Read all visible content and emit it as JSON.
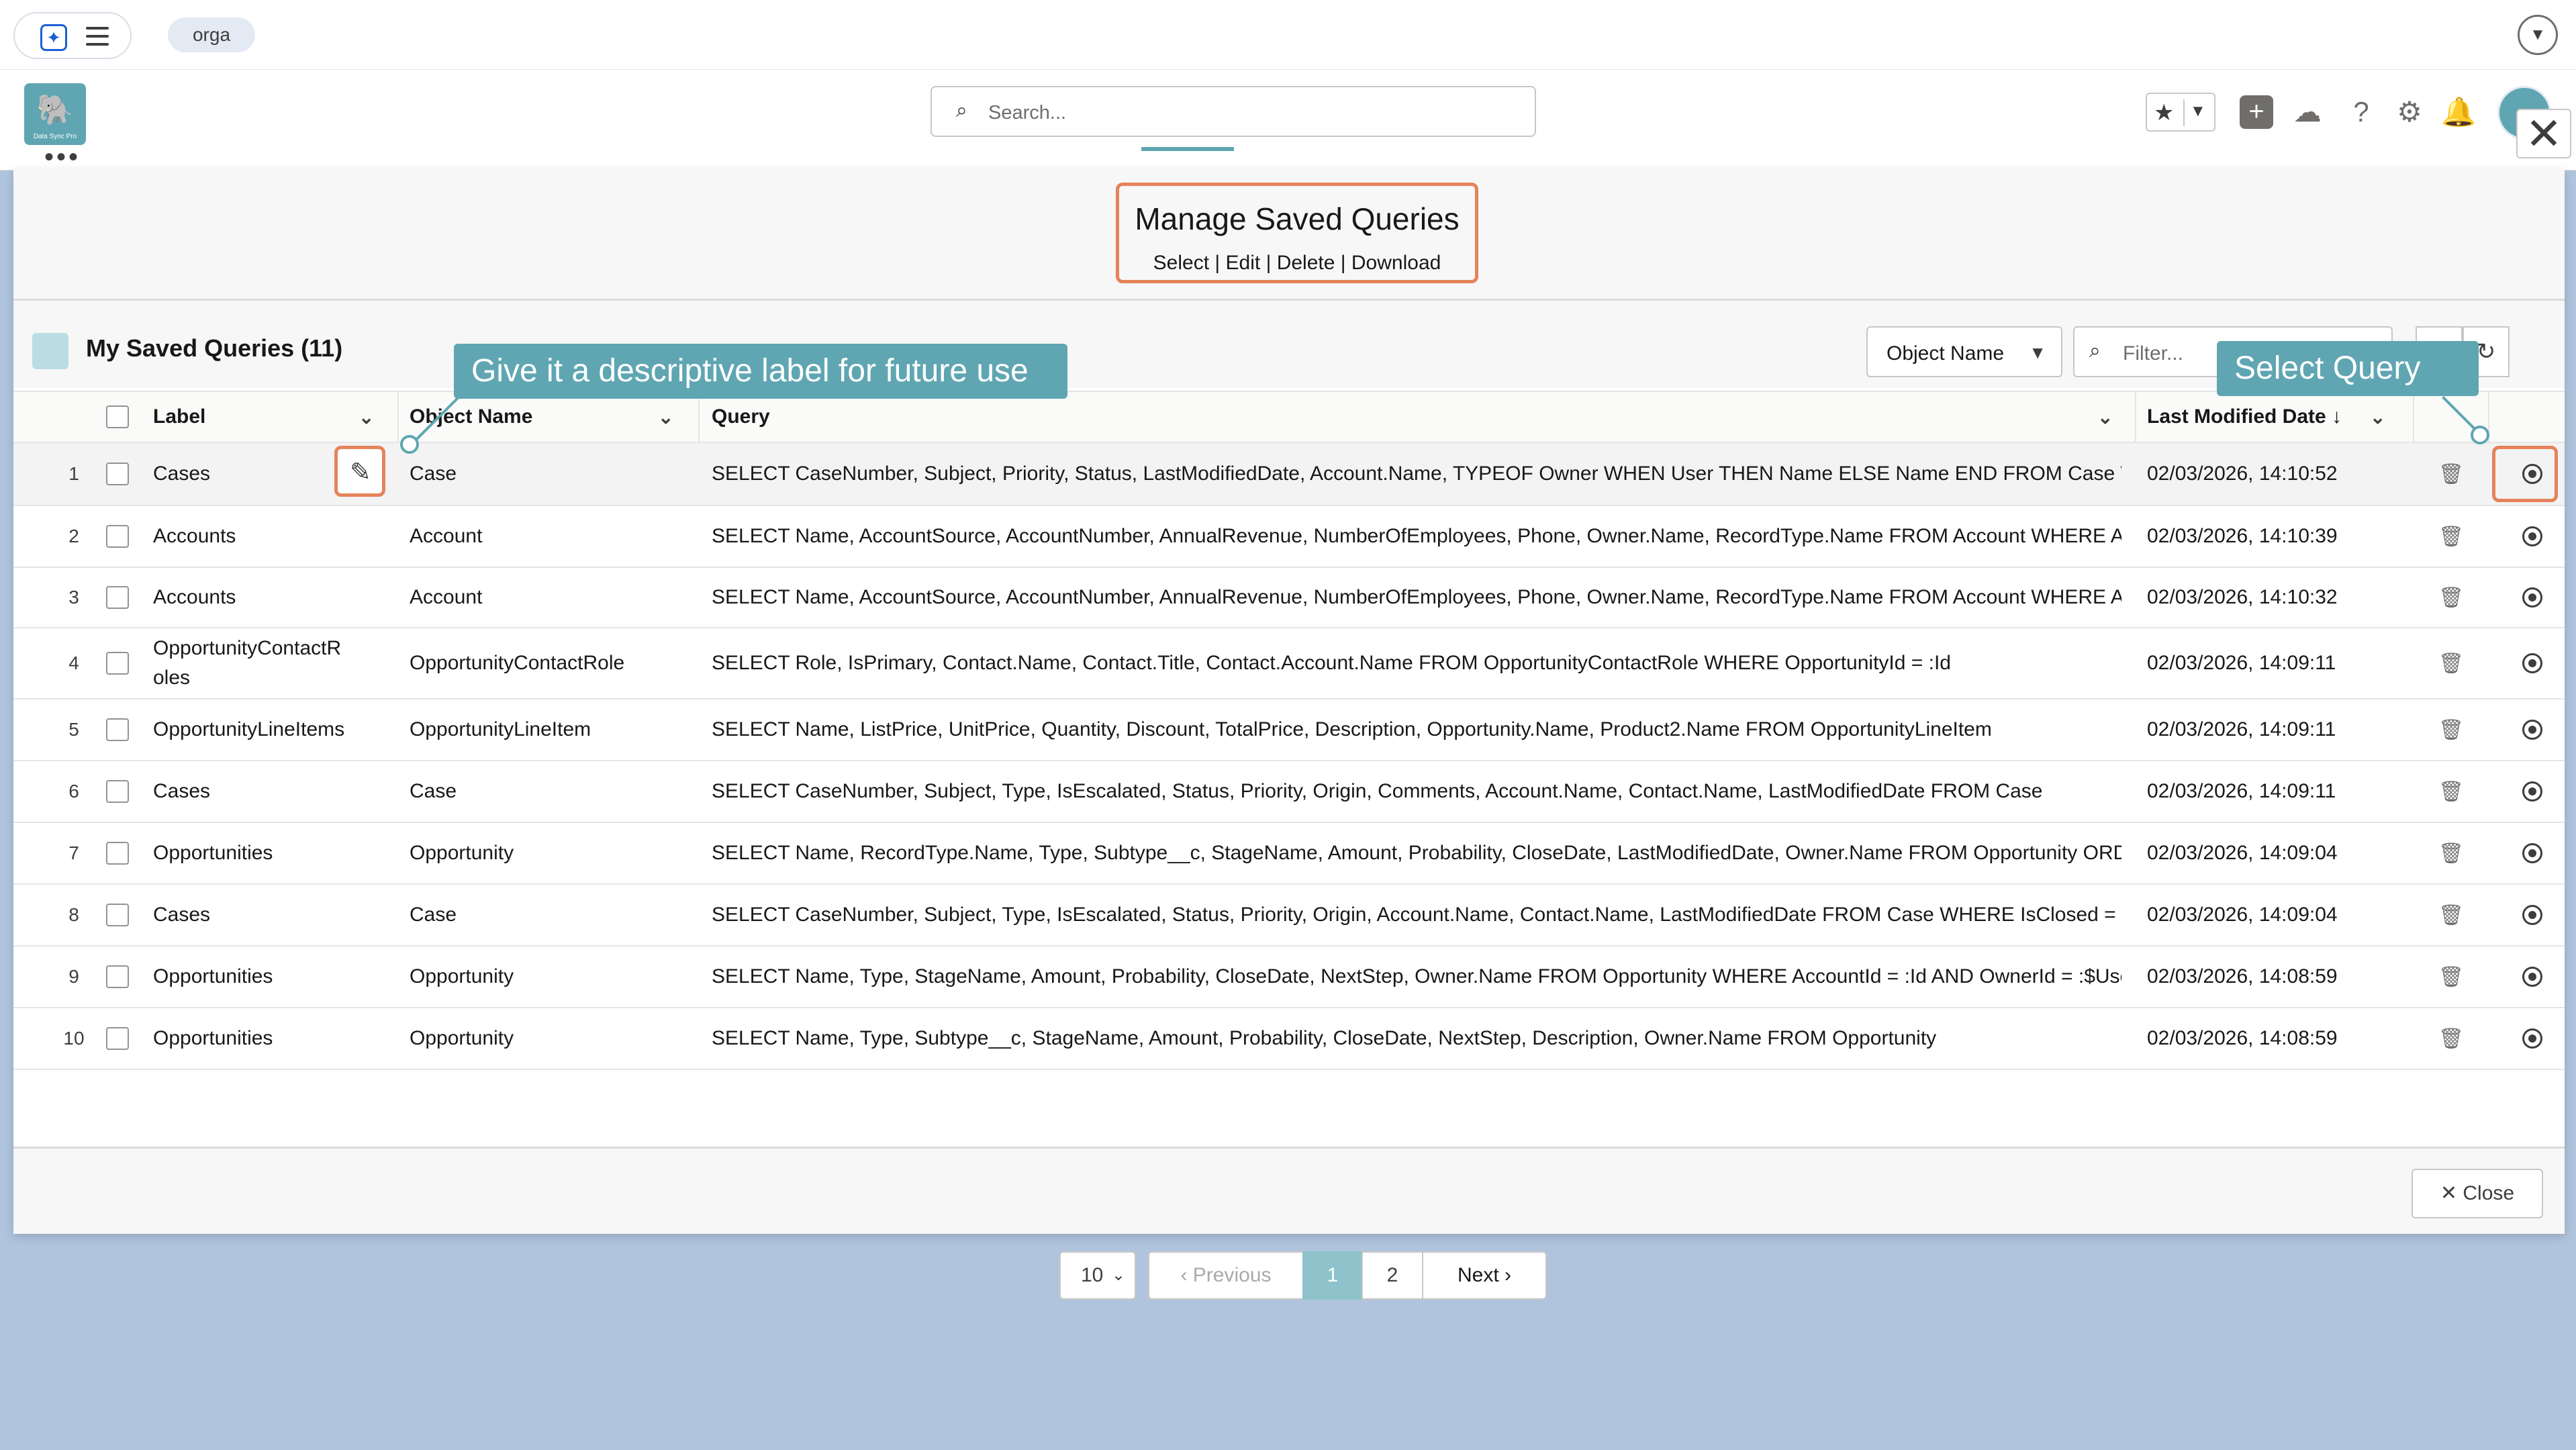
{
  "topbar": {
    "org": "orga"
  },
  "search": {
    "placeholder": "Search..."
  },
  "modal": {
    "title": "Manage Saved Queries",
    "actions": [
      "Select",
      "Edit",
      "Delete",
      "Download"
    ],
    "list_title": "My Saved Queries (11)",
    "object_filter": "Object Name",
    "filter_placeholder": "Filter...",
    "close_label": "Close"
  },
  "callouts": {
    "label_tip": "Give it a descriptive label for future use",
    "select_tip": "Select Query"
  },
  "columns": {
    "label": "Label",
    "object": "Object Name",
    "query": "Query",
    "modified": "Last Modified Date ↓"
  },
  "rows": [
    {
      "n": "1",
      "label": "Cases",
      "object": "Case",
      "query": "SELECT CaseNumber, Subject, Priority, Status, LastModifiedDate, Account.Name, TYPEOF Owner WHEN User THEN Name ELSE Name END FROM Case WHER...",
      "modified": "02/03/2026, 14:10:52"
    },
    {
      "n": "2",
      "label": "Accounts",
      "object": "Account",
      "query": "SELECT Name, AccountSource, AccountNumber, AnnualRevenue, NumberOfEmployees, Phone, Owner.Name, RecordType.Name FROM Account WHERE Acc...",
      "modified": "02/03/2026, 14:10:39"
    },
    {
      "n": "3",
      "label": "Accounts",
      "object": "Account",
      "query": "SELECT Name, AccountSource, AccountNumber, AnnualRevenue, NumberOfEmployees, Phone, Owner.Name, RecordType.Name FROM Account WHERE Acc...",
      "modified": "02/03/2026, 14:10:32"
    },
    {
      "n": "4",
      "label": "OpportunityContactR oles",
      "object": "OpportunityContactRole",
      "query": "SELECT Role, IsPrimary, Contact.Name, Contact.Title, Contact.Account.Name FROM OpportunityContactRole WHERE OpportunityId = :Id",
      "modified": "02/03/2026, 14:09:11"
    },
    {
      "n": "5",
      "label": "OpportunityLineItems",
      "object": "OpportunityLineItem",
      "query": "SELECT Name, ListPrice, UnitPrice, Quantity, Discount, TotalPrice, Description, Opportunity.Name, Product2.Name FROM OpportunityLineItem",
      "modified": "02/03/2026, 14:09:11"
    },
    {
      "n": "6",
      "label": "Cases",
      "object": "Case",
      "query": "SELECT CaseNumber, Subject, Type, IsEscalated, Status, Priority, Origin, Comments, Account.Name, Contact.Name, LastModifiedDate FROM Case",
      "modified": "02/03/2026, 14:09:11"
    },
    {
      "n": "7",
      "label": "Opportunities",
      "object": "Opportunity",
      "query": "SELECT Name, RecordType.Name, Type, Subtype__c, StageName, Amount, Probability, CloseDate, LastModifiedDate, Owner.Name FROM Opportunity ORDE...",
      "modified": "02/03/2026, 14:09:04"
    },
    {
      "n": "8",
      "label": "Cases",
      "object": "Case",
      "query": "SELECT CaseNumber, Subject, Type, IsEscalated, Status, Priority, Origin, Account.Name, Contact.Name, LastModifiedDate FROM Case WHERE IsClosed = TRU...",
      "modified": "02/03/2026, 14:09:04"
    },
    {
      "n": "9",
      "label": "Opportunities",
      "object": "Opportunity",
      "query": "SELECT Name, Type, StageName, Amount, Probability, CloseDate, NextStep, Owner.Name FROM Opportunity WHERE AccountId = :Id AND OwnerId = :$User...",
      "modified": "02/03/2026, 14:08:59"
    },
    {
      "n": "10",
      "label": "Opportunities",
      "object": "Opportunity",
      "query": "SELECT Name, Type, Subtype__c, StageName, Amount, Probability, CloseDate, NextStep, Description, Owner.Name FROM Opportunity",
      "modified": "02/03/2026, 14:08:59"
    }
  ],
  "pagination": {
    "page_size": "10",
    "previous": "Previous",
    "page1": "1",
    "page2": "2",
    "next": "Next"
  },
  "colors": {
    "accent": "#5fa6b2",
    "highlight": "#e5835a",
    "backdrop": "#b0c4de"
  }
}
